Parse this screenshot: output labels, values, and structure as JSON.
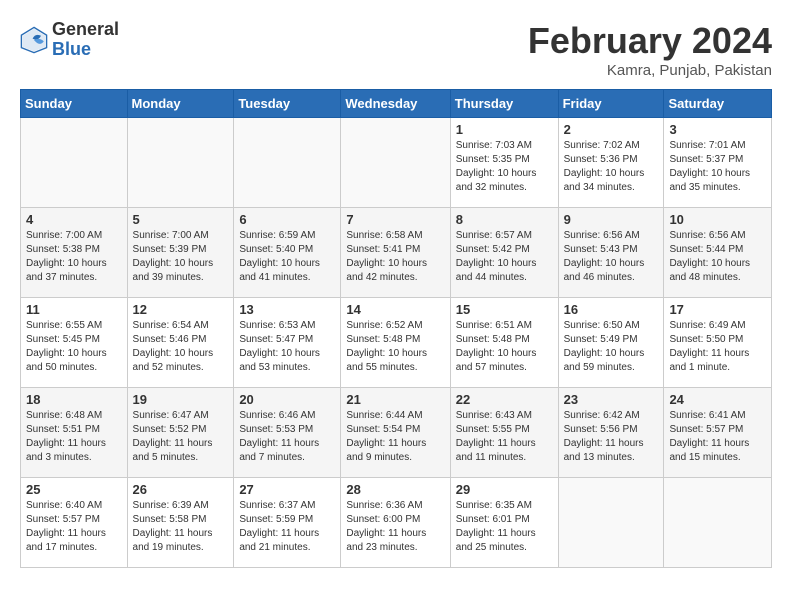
{
  "header": {
    "logo": {
      "general": "General",
      "blue": "Blue"
    },
    "title": "February 2024",
    "location": "Kamra, Punjab, Pakistan"
  },
  "calendar": {
    "weekdays": [
      "Sunday",
      "Monday",
      "Tuesday",
      "Wednesday",
      "Thursday",
      "Friday",
      "Saturday"
    ],
    "weeks": [
      [
        {
          "day": "",
          "info": ""
        },
        {
          "day": "",
          "info": ""
        },
        {
          "day": "",
          "info": ""
        },
        {
          "day": "",
          "info": ""
        },
        {
          "day": "1",
          "info": "Sunrise: 7:03 AM\nSunset: 5:35 PM\nDaylight: 10 hours\nand 32 minutes."
        },
        {
          "day": "2",
          "info": "Sunrise: 7:02 AM\nSunset: 5:36 PM\nDaylight: 10 hours\nand 34 minutes."
        },
        {
          "day": "3",
          "info": "Sunrise: 7:01 AM\nSunset: 5:37 PM\nDaylight: 10 hours\nand 35 minutes."
        }
      ],
      [
        {
          "day": "4",
          "info": "Sunrise: 7:00 AM\nSunset: 5:38 PM\nDaylight: 10 hours\nand 37 minutes."
        },
        {
          "day": "5",
          "info": "Sunrise: 7:00 AM\nSunset: 5:39 PM\nDaylight: 10 hours\nand 39 minutes."
        },
        {
          "day": "6",
          "info": "Sunrise: 6:59 AM\nSunset: 5:40 PM\nDaylight: 10 hours\nand 41 minutes."
        },
        {
          "day": "7",
          "info": "Sunrise: 6:58 AM\nSunset: 5:41 PM\nDaylight: 10 hours\nand 42 minutes."
        },
        {
          "day": "8",
          "info": "Sunrise: 6:57 AM\nSunset: 5:42 PM\nDaylight: 10 hours\nand 44 minutes."
        },
        {
          "day": "9",
          "info": "Sunrise: 6:56 AM\nSunset: 5:43 PM\nDaylight: 10 hours\nand 46 minutes."
        },
        {
          "day": "10",
          "info": "Sunrise: 6:56 AM\nSunset: 5:44 PM\nDaylight: 10 hours\nand 48 minutes."
        }
      ],
      [
        {
          "day": "11",
          "info": "Sunrise: 6:55 AM\nSunset: 5:45 PM\nDaylight: 10 hours\nand 50 minutes."
        },
        {
          "day": "12",
          "info": "Sunrise: 6:54 AM\nSunset: 5:46 PM\nDaylight: 10 hours\nand 52 minutes."
        },
        {
          "day": "13",
          "info": "Sunrise: 6:53 AM\nSunset: 5:47 PM\nDaylight: 10 hours\nand 53 minutes."
        },
        {
          "day": "14",
          "info": "Sunrise: 6:52 AM\nSunset: 5:48 PM\nDaylight: 10 hours\nand 55 minutes."
        },
        {
          "day": "15",
          "info": "Sunrise: 6:51 AM\nSunset: 5:48 PM\nDaylight: 10 hours\nand 57 minutes."
        },
        {
          "day": "16",
          "info": "Sunrise: 6:50 AM\nSunset: 5:49 PM\nDaylight: 10 hours\nand 59 minutes."
        },
        {
          "day": "17",
          "info": "Sunrise: 6:49 AM\nSunset: 5:50 PM\nDaylight: 11 hours\nand 1 minute."
        }
      ],
      [
        {
          "day": "18",
          "info": "Sunrise: 6:48 AM\nSunset: 5:51 PM\nDaylight: 11 hours\nand 3 minutes."
        },
        {
          "day": "19",
          "info": "Sunrise: 6:47 AM\nSunset: 5:52 PM\nDaylight: 11 hours\nand 5 minutes."
        },
        {
          "day": "20",
          "info": "Sunrise: 6:46 AM\nSunset: 5:53 PM\nDaylight: 11 hours\nand 7 minutes."
        },
        {
          "day": "21",
          "info": "Sunrise: 6:44 AM\nSunset: 5:54 PM\nDaylight: 11 hours\nand 9 minutes."
        },
        {
          "day": "22",
          "info": "Sunrise: 6:43 AM\nSunset: 5:55 PM\nDaylight: 11 hours\nand 11 minutes."
        },
        {
          "day": "23",
          "info": "Sunrise: 6:42 AM\nSunset: 5:56 PM\nDaylight: 11 hours\nand 13 minutes."
        },
        {
          "day": "24",
          "info": "Sunrise: 6:41 AM\nSunset: 5:57 PM\nDaylight: 11 hours\nand 15 minutes."
        }
      ],
      [
        {
          "day": "25",
          "info": "Sunrise: 6:40 AM\nSunset: 5:57 PM\nDaylight: 11 hours\nand 17 minutes."
        },
        {
          "day": "26",
          "info": "Sunrise: 6:39 AM\nSunset: 5:58 PM\nDaylight: 11 hours\nand 19 minutes."
        },
        {
          "day": "27",
          "info": "Sunrise: 6:37 AM\nSunset: 5:59 PM\nDaylight: 11 hours\nand 21 minutes."
        },
        {
          "day": "28",
          "info": "Sunrise: 6:36 AM\nSunset: 6:00 PM\nDaylight: 11 hours\nand 23 minutes."
        },
        {
          "day": "29",
          "info": "Sunrise: 6:35 AM\nSunset: 6:01 PM\nDaylight: 11 hours\nand 25 minutes."
        },
        {
          "day": "",
          "info": ""
        },
        {
          "day": "",
          "info": ""
        }
      ]
    ]
  }
}
